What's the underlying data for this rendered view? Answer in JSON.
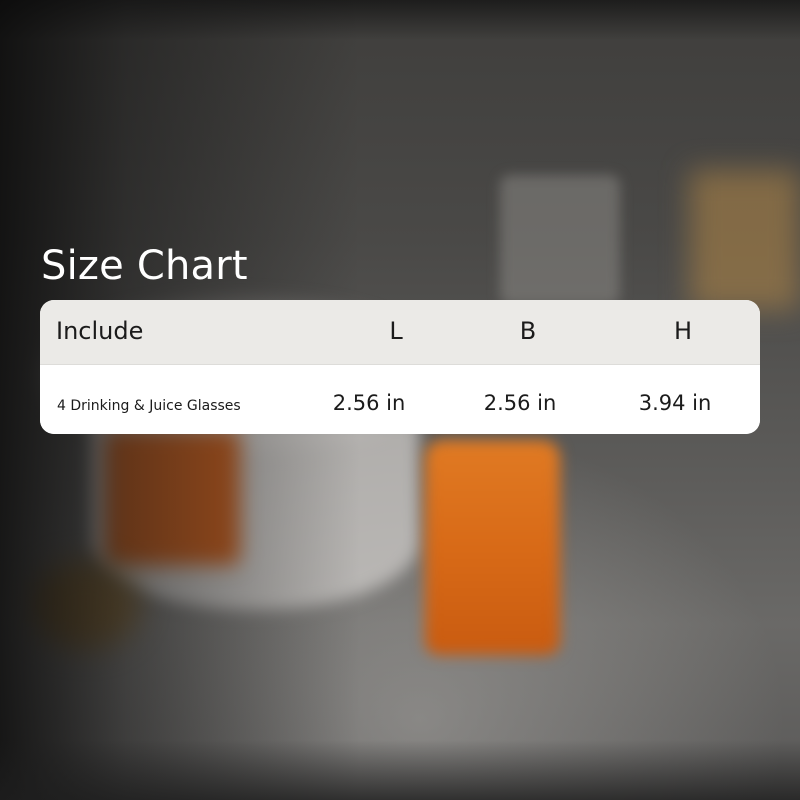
{
  "title": "Size Chart",
  "table": {
    "headers": {
      "include": "Include",
      "l": "L",
      "b": "B",
      "h": "H"
    },
    "rows": [
      {
        "include": "4 Drinking & Juice Glasses",
        "l": "2.56 in",
        "b": "2.56 in",
        "h": "3.94 in"
      }
    ]
  },
  "colors": {
    "header_bg": "#ebeae7",
    "row_bg": "#ffffff",
    "title_text": "#ffffff",
    "table_text": "#1b1b1b"
  }
}
